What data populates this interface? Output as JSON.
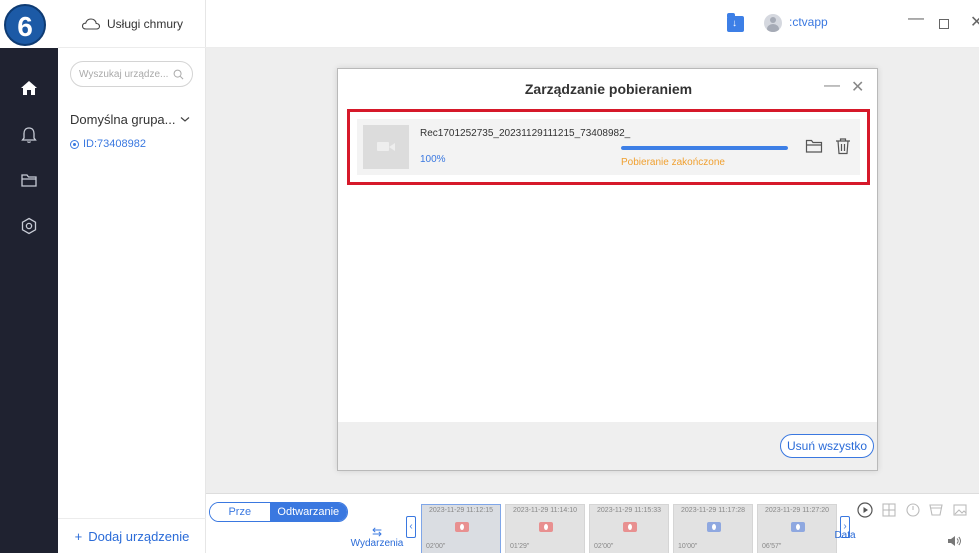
{
  "step_badge": "6",
  "colors": {
    "nav_bg": "#1f2230",
    "accent": "#3d7fe6",
    "highlight_border": "#d6192a",
    "status_done": "#f0a030"
  },
  "sidebar_nav": {
    "items": [
      {
        "icon": "home-icon",
        "active": true
      },
      {
        "icon": "bell-icon",
        "active": false
      },
      {
        "icon": "folder-icon",
        "active": false
      },
      {
        "icon": "settings-hex-icon",
        "active": false
      }
    ]
  },
  "device_panel": {
    "cloud_services_label": "Usługi chmury",
    "search_placeholder": "Wyszukaj urządze...",
    "group_name": "Domyślna grupa...",
    "device_id": "ID:73408982",
    "add_device_label": "Dodaj urządzenie",
    "add_device_icon": "+"
  },
  "titlebar": {
    "download_icon": "download-folder-icon",
    "download_glyph": "↓",
    "username": ":ctvapp",
    "minimize": "—",
    "close": "✕"
  },
  "download_modal": {
    "title": "Zarządzanie pobieraniem",
    "minimize": "—",
    "close": "✕",
    "item": {
      "file_name": "Rec1701252735_20231129111215_73408982_",
      "percent_text": "100%",
      "progress": 1.0,
      "status": "Pobieranie zakończone"
    },
    "clear_all_label": "Usuń wszystko"
  },
  "bottom_bar": {
    "mode_tabs": [
      "Prze",
      "Odtwarzanie"
    ],
    "events_label": "Wydarzenia",
    "events_icon": "⇆",
    "prev_arrow": "‹",
    "next_arrow": "›",
    "data_label": "Data",
    "clips": [
      {
        "time": "2023-11-29 11:12:15",
        "duration": "02'00\"",
        "color": "#e89090",
        "selected": true
      },
      {
        "time": "2023-11-29 11:14:10",
        "duration": "01'29\"",
        "color": "#e89090",
        "selected": false
      },
      {
        "time": "2023-11-29 11:15:33",
        "duration": "02'00\"",
        "color": "#e89090",
        "selected": false
      },
      {
        "time": "2023-11-29 11:17:28",
        "duration": "10'00\"",
        "color": "#8fa8e0",
        "selected": false
      },
      {
        "time": "2023-11-29 11:27:20",
        "duration": "06'57\"",
        "color": "#8fa8e0",
        "selected": false
      }
    ]
  }
}
